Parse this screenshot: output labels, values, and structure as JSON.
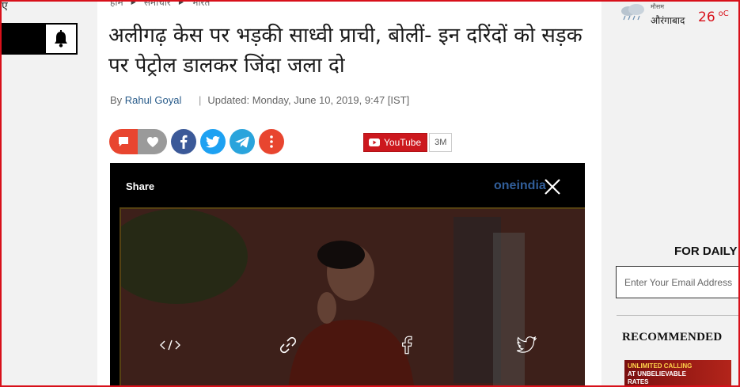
{
  "left_rail": {
    "letter": "ए"
  },
  "breadcrumb": [
    "होम",
    "समाचार",
    "भारत"
  ],
  "article": {
    "headline": "अलीगढ़ केस पर भड़की साध्वी प्राची, बोलीं- इन दरिंदों को सड़क पर पेट्रोल डालकर जिंदा जला दो",
    "by_label": "By",
    "author": "Rahul Goyal",
    "updated": "Updated: Monday, June 10, 2019, 9:47 [IST]"
  },
  "social": {
    "buttons": [
      "comment-icon",
      "heart-icon",
      "facebook-icon",
      "twitter-icon",
      "telegram-icon",
      "more-icon"
    ],
    "colors": {
      "orange": "#e8452f",
      "grey": "#9a9a9a",
      "facebook": "#3b5998",
      "twitter": "#1da1f2",
      "telegram": "#2aa4dc"
    },
    "youtube_label": "YouTube",
    "youtube_count": "3M"
  },
  "video": {
    "share_title": "Share",
    "watermark": "oneindia",
    "share_options": [
      "embed-icon",
      "link-icon",
      "facebook-icon",
      "twitter-icon"
    ]
  },
  "weather": {
    "label": "मौसम",
    "city": "औरंगाबाद",
    "temp": "26",
    "unit": "oC"
  },
  "newsletter": {
    "heading": "FOR DAILY",
    "placeholder": "Enter Your Email Address"
  },
  "recommended": {
    "heading": "RECOMMENDED",
    "ad_line1": "UNLIMITED CALLING",
    "ad_line2": "AT UNBELIEVABLE",
    "ad_line3": "RATES"
  },
  "accent_color": "#d8101a"
}
